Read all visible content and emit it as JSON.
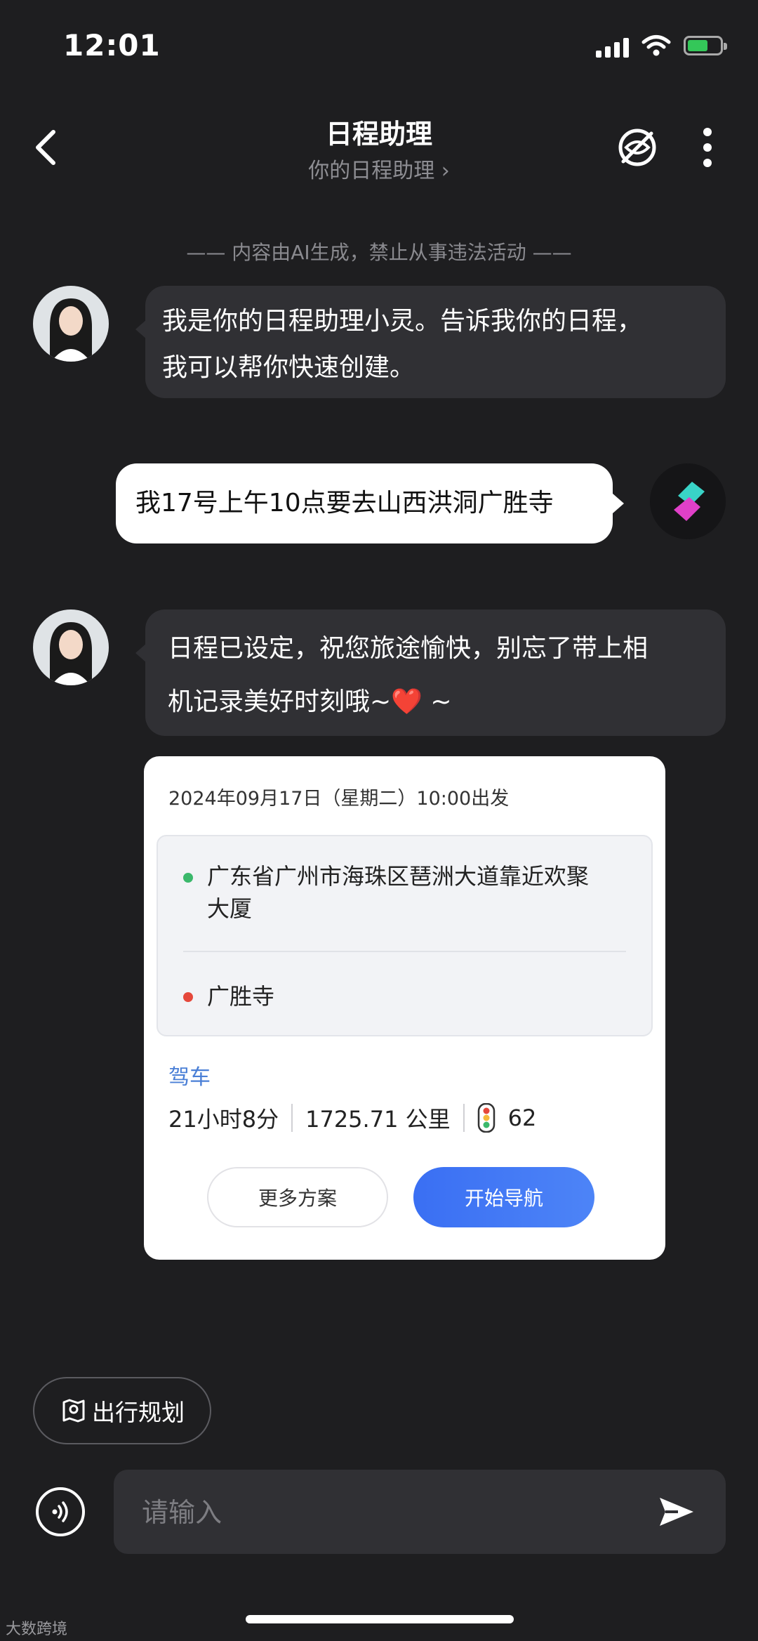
{
  "status_bar": {
    "time": "12:01"
  },
  "header": {
    "title": "日程助理",
    "subtitle": "你的日程助理",
    "icons": [
      "back-icon",
      "hide-eye-icon",
      "more-vertical-icon"
    ]
  },
  "notice": "内容由AI生成，禁止从事违法活动",
  "messages": {
    "assistant_greeting": [
      "我是你的日程助理小灵。告诉我你的日程，",
      "我可以帮你快速创建。"
    ],
    "user_message": "我17号上午10点要去山西洪洞广胜寺",
    "assistant_reply": [
      "日程已设定，祝您旅途愉快，别忘了带上相",
      "机记录美好时刻哦~❤️ ~"
    ]
  },
  "route_card": {
    "date_line": "2024年09月17日（星期二）10:00出发",
    "origin": [
      "广东省广州市海珠区琶洲大道靠近欢聚",
      "大厦"
    ],
    "destination": "广胜寺",
    "mode": "驾车",
    "duration": "21小时8分",
    "distance": "1725.71 公里",
    "traffic_lights": "62",
    "more_button": "更多方案",
    "nav_button": "开始导航",
    "colors": {
      "origin_dot": "#3bb86b",
      "destination_dot": "#e5483b",
      "accent": "#3a6ff3"
    }
  },
  "bottom": {
    "chip_label": "出行规划",
    "input_placeholder": "请输入",
    "watermark": "大数跨境"
  }
}
